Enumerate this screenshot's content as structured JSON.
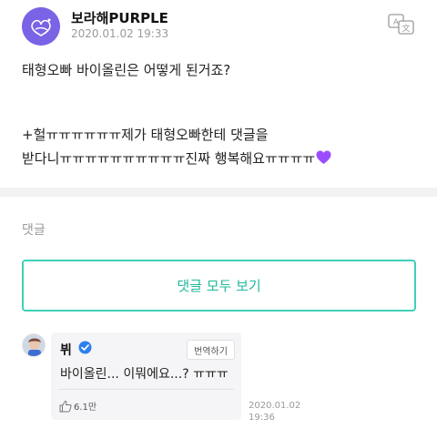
{
  "header": {
    "username": "보라해PURPLE",
    "timestamp": "2020.01.02 19:33",
    "translate_icon": "translate-icon"
  },
  "post": {
    "line1": "태형오빠 바이올린은 어떻게 된거죠?",
    "line2": "+헐ㅠㅠㅠㅠㅠㅠ제가 태형오빠한테 댓글을",
    "line3": "받다니ㅠㅠㅠㅠㅠㅠㅠㅠㅠㅠ진짜 행복해요ㅠㅠㅠㅠ",
    "emoji": "purple-heart"
  },
  "comments": {
    "label": "댓글",
    "view_all_label": "댓글 모두 보기",
    "items": [
      {
        "author": "뷔",
        "verified": true,
        "translate_label": "번역하기",
        "text": "바이올린... 이뭐에요...? ㅠㅠㅠ",
        "likes": "6.1만",
        "date": "2020.01.02",
        "time": "19:36"
      }
    ]
  },
  "colors": {
    "accent": "#3fd1b7",
    "accent_text": "#21b89c",
    "verified": "#2f80ed",
    "heart": "#9b4dff"
  }
}
